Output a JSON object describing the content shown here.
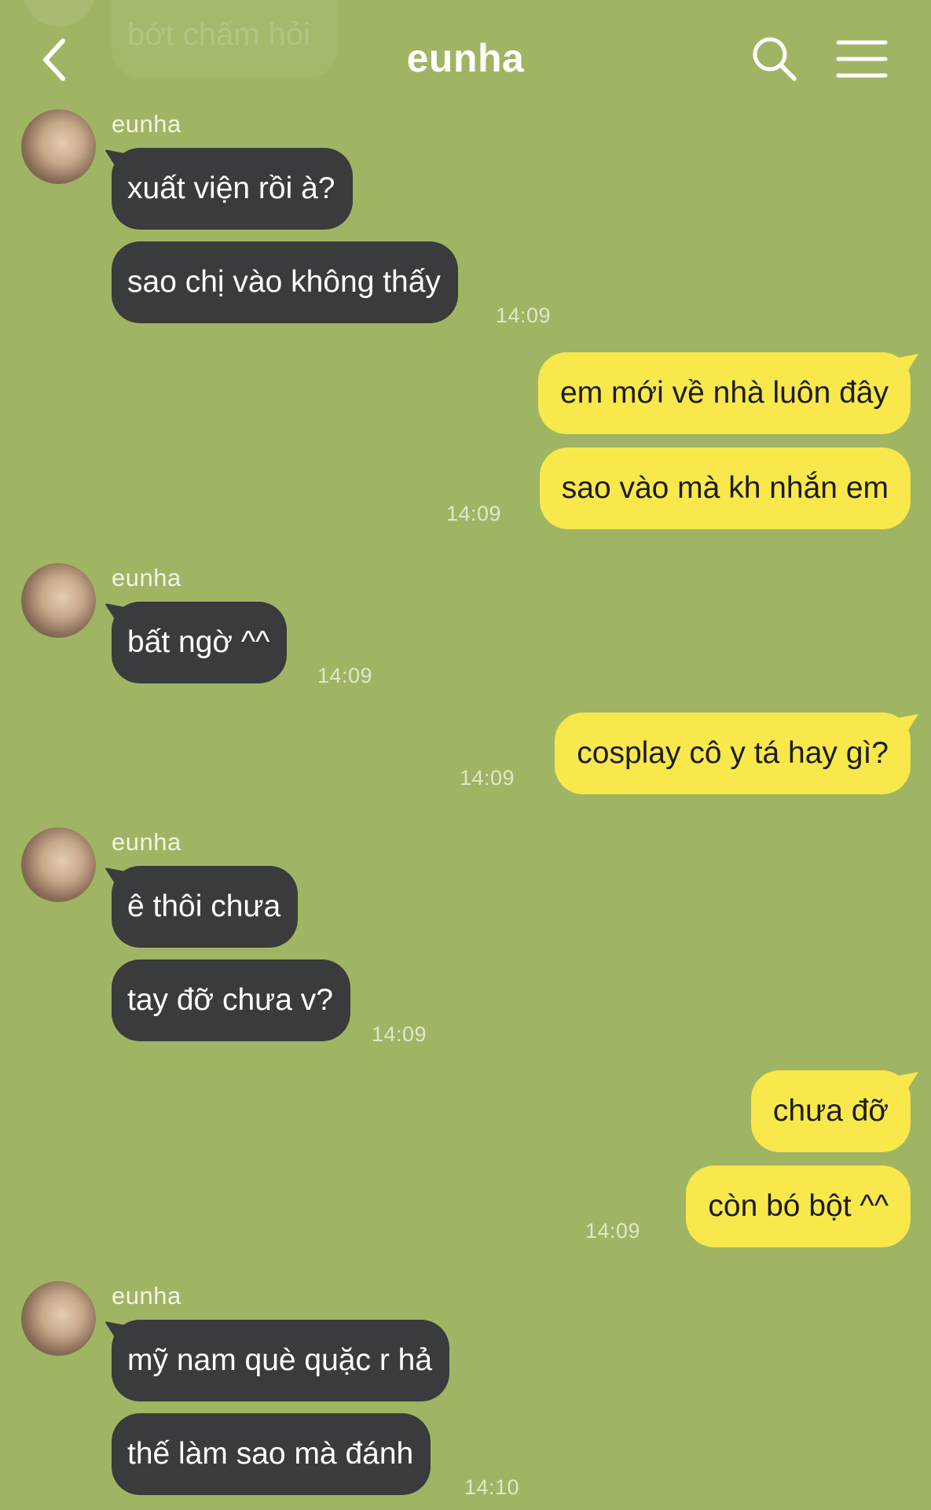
{
  "header": {
    "title": "eunha",
    "ghost_message": "bớt chấm hỏi",
    "back_icon": "chevron-left-icon",
    "search_icon": "search-icon",
    "menu_icon": "hamburger-menu-icon"
  },
  "colors": {
    "background": "#a0b564",
    "incoming_bubble": "#3a3b3d",
    "outgoing_bubble": "#f9e84b"
  },
  "messages": [
    {
      "sender": "eunha"
    },
    {
      "text": "xuất viện rồi à?"
    },
    {
      "text": "sao chị vào không thấy",
      "time": "14:09"
    },
    {
      "text": "em mới về nhà luôn đây"
    },
    {
      "text": "sao vào mà kh nhắn em",
      "time": "14:09"
    },
    {
      "sender": "eunha"
    },
    {
      "text": "bất ngờ ^^",
      "time": "14:09"
    },
    {
      "text": "cosplay cô y tá hay gì?",
      "time": "14:09"
    },
    {
      "sender": "eunha"
    },
    {
      "text": "ê thôi chưa"
    },
    {
      "text": "tay đỡ chưa v?",
      "time": "14:09"
    },
    {
      "text": "chưa đỡ"
    },
    {
      "text": "còn bó bột ^^",
      "time": "14:09"
    },
    {
      "sender": "eunha"
    },
    {
      "text": "mỹ nam què quặc r hả"
    },
    {
      "text": "thế làm sao mà đánh",
      "time": "14:10"
    }
  ]
}
